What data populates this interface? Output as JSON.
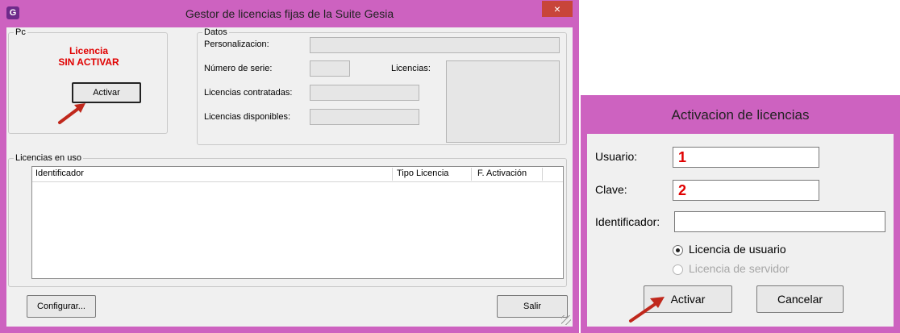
{
  "main_window": {
    "title": "Gestor de licencias fijas de la Suite Gesia",
    "close_glyph": "×",
    "app_icon_glyph": "G",
    "pc_group": {
      "legend": "Pc",
      "status_line1": "Licencia",
      "status_line2": "SIN ACTIVAR",
      "activate_button": "Activar"
    },
    "datos_group": {
      "legend": "Datos",
      "personalizacion_label": "Personalizacion:",
      "numero_serie_label": "Número de serie:",
      "licencias_label": "Licencias:",
      "contratadas_label": "Licencias contratadas:",
      "disponibles_label": "Licencias disponibles:"
    },
    "in_use_group": {
      "legend": "Licencias en uso",
      "columns": [
        "Identificador",
        "Tipo Licencia",
        "F. Activación"
      ]
    },
    "configure_button": "Configurar...",
    "exit_button": "Salir"
  },
  "dialog": {
    "title": "Activacion de licencias",
    "usuario_label": "Usuario:",
    "usuario_value": "1",
    "clave_label": "Clave:",
    "clave_value": "2",
    "identificador_label": "Identificador:",
    "identificador_value": "",
    "radio_user": "Licencia de usuario",
    "radio_user_checked": true,
    "radio_server": "Licencia de servidor",
    "radio_server_enabled": false,
    "activate_button": "Activar",
    "cancel_button": "Cancelar"
  },
  "colors": {
    "titlebar": "#cd62c0",
    "status_red": "#e00000",
    "arrow": "#c0281c",
    "close": "#c8453a"
  },
  "icons": [
    "app-icon",
    "close-icon",
    "pointer-arrow-icon",
    "resize-grip-icon"
  ]
}
